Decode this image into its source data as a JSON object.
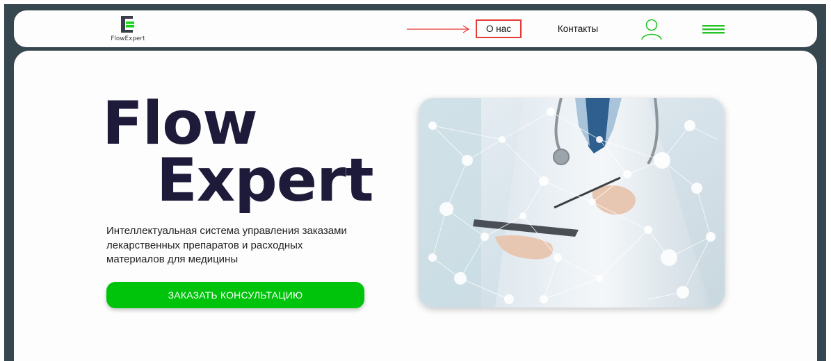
{
  "header": {
    "logo_text": "FlowExpert",
    "nav": {
      "about_label": "О нас",
      "contacts_label": "Контакты"
    },
    "icons": {
      "user": "user-icon",
      "menu": "hamburger-menu-icon",
      "annotation": "arrow-right-icon"
    }
  },
  "hero": {
    "title_line1": "Flow",
    "title_line2": "Expert",
    "description_lines": [
      "Интеллектуальная система управления заказами",
      "лекарственных препаратов и расходных",
      "материалов для медицины"
    ],
    "cta_label": "ЗАКАЗАТЬ КОНСУЛЬТАЦИЮ"
  },
  "colors": {
    "accent_green": "#00c40c",
    "title_navy": "#1d1a3a",
    "frame_dark": "#37474f",
    "annotation_red": "#e53935"
  }
}
